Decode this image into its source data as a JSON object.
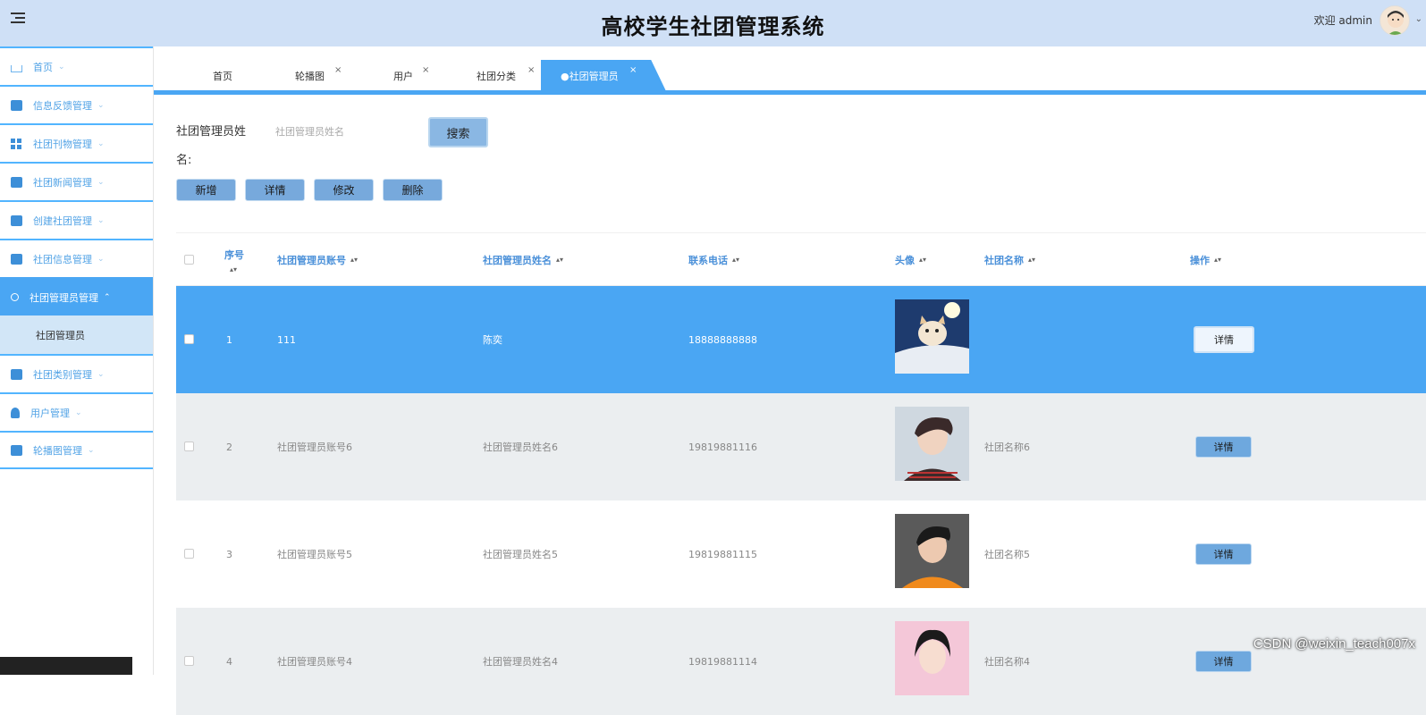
{
  "header": {
    "title": "高校学生社团管理系统",
    "welcome": "欢迎 admin"
  },
  "sidebar": {
    "items": [
      {
        "label": "首页",
        "icon": "home-icon"
      },
      {
        "label": "信息反馈管理",
        "icon": "image-icon"
      },
      {
        "label": "社团刊物管理",
        "icon": "grid-icon"
      },
      {
        "label": "社团新闻管理",
        "icon": "layout-icon"
      },
      {
        "label": "创建社团管理",
        "icon": "gift-icon"
      },
      {
        "label": "社团信息管理",
        "icon": "image-icon"
      },
      {
        "label": "社团管理员管理",
        "icon": "person-icon"
      },
      {
        "label": "社团类别管理",
        "icon": "store-icon"
      },
      {
        "label": "用户管理",
        "icon": "user-icon"
      },
      {
        "label": "轮播图管理",
        "icon": "image-icon"
      }
    ],
    "sub_item": "社团管理员"
  },
  "tabs": [
    {
      "label": "首页"
    },
    {
      "label": "轮播图",
      "close": "×"
    },
    {
      "label": "用户",
      "close": "×"
    },
    {
      "label": "社团分类",
      "close": "×"
    },
    {
      "label": "●社团管理员",
      "close": "×"
    }
  ],
  "search": {
    "label_line1": "社团管理员姓",
    "label_line2": "名:",
    "placeholder": "社团管理员姓名",
    "button": "搜索"
  },
  "actions": {
    "add": "新增",
    "detail": "详情",
    "edit": "修改",
    "delete": "删除"
  },
  "table": {
    "headers": {
      "index": "序号",
      "account": "社团管理员账号",
      "name": "社团管理员姓名",
      "phone": "联系电话",
      "avatar": "头像",
      "club": "社团名称",
      "ops": "操作"
    },
    "rows": [
      {
        "index": "1",
        "account": "111",
        "name": "陈奕",
        "phone": "18888888888",
        "club": "",
        "op": "详情"
      },
      {
        "index": "2",
        "account": "社团管理员账号6",
        "name": "社团管理员姓名6",
        "phone": "19819881116",
        "club": "社团名称6",
        "op": "详情"
      },
      {
        "index": "3",
        "account": "社团管理员账号5",
        "name": "社团管理员姓名5",
        "phone": "19819881115",
        "club": "社团名称5",
        "op": "详情"
      },
      {
        "index": "4",
        "account": "社团管理员账号4",
        "name": "社团管理员姓名4",
        "phone": "19819881114",
        "club": "社团名称4",
        "op": "详情"
      }
    ]
  },
  "watermark": "CSDN @weixin_teach007x",
  "colors": {
    "header_bg": "#cfe0f6",
    "accent": "#4aa6f3",
    "selected_row": "#4aa6f3",
    "alt_row": "#ebeef0"
  }
}
